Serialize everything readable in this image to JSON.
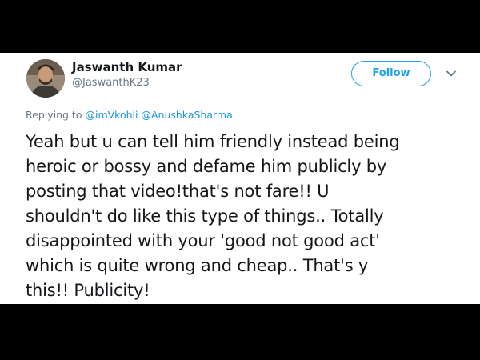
{
  "tweet": {
    "author": {
      "display_name": "Jaswanth Kumar",
      "handle": "@JaswanthK23",
      "avatar_icon": "profile-photo"
    },
    "follow_label": "Follow",
    "menu_icon": "chevron-down-icon",
    "reply": {
      "prefix": "Replying to",
      "mention_1": "@imVkohli",
      "mention_2": "@AnushkaSharma"
    },
    "text_lines": [
      "Yeah but u can tell him friendly instead being",
      "heroic or bossy and defame him publicly by",
      "posting that video!that's not fare!! U",
      "shouldn't do like this type of things.. Totally",
      "disappointed with your 'good not good act'",
      "which is quite wrong and cheap.. That's y",
      "this!! Publicity!"
    ]
  },
  "colors": {
    "accent": "#1da1f2",
    "mention": "#1b95e0",
    "text": "#14171a",
    "secondary": "#657786",
    "letterbox": "#000000"
  }
}
